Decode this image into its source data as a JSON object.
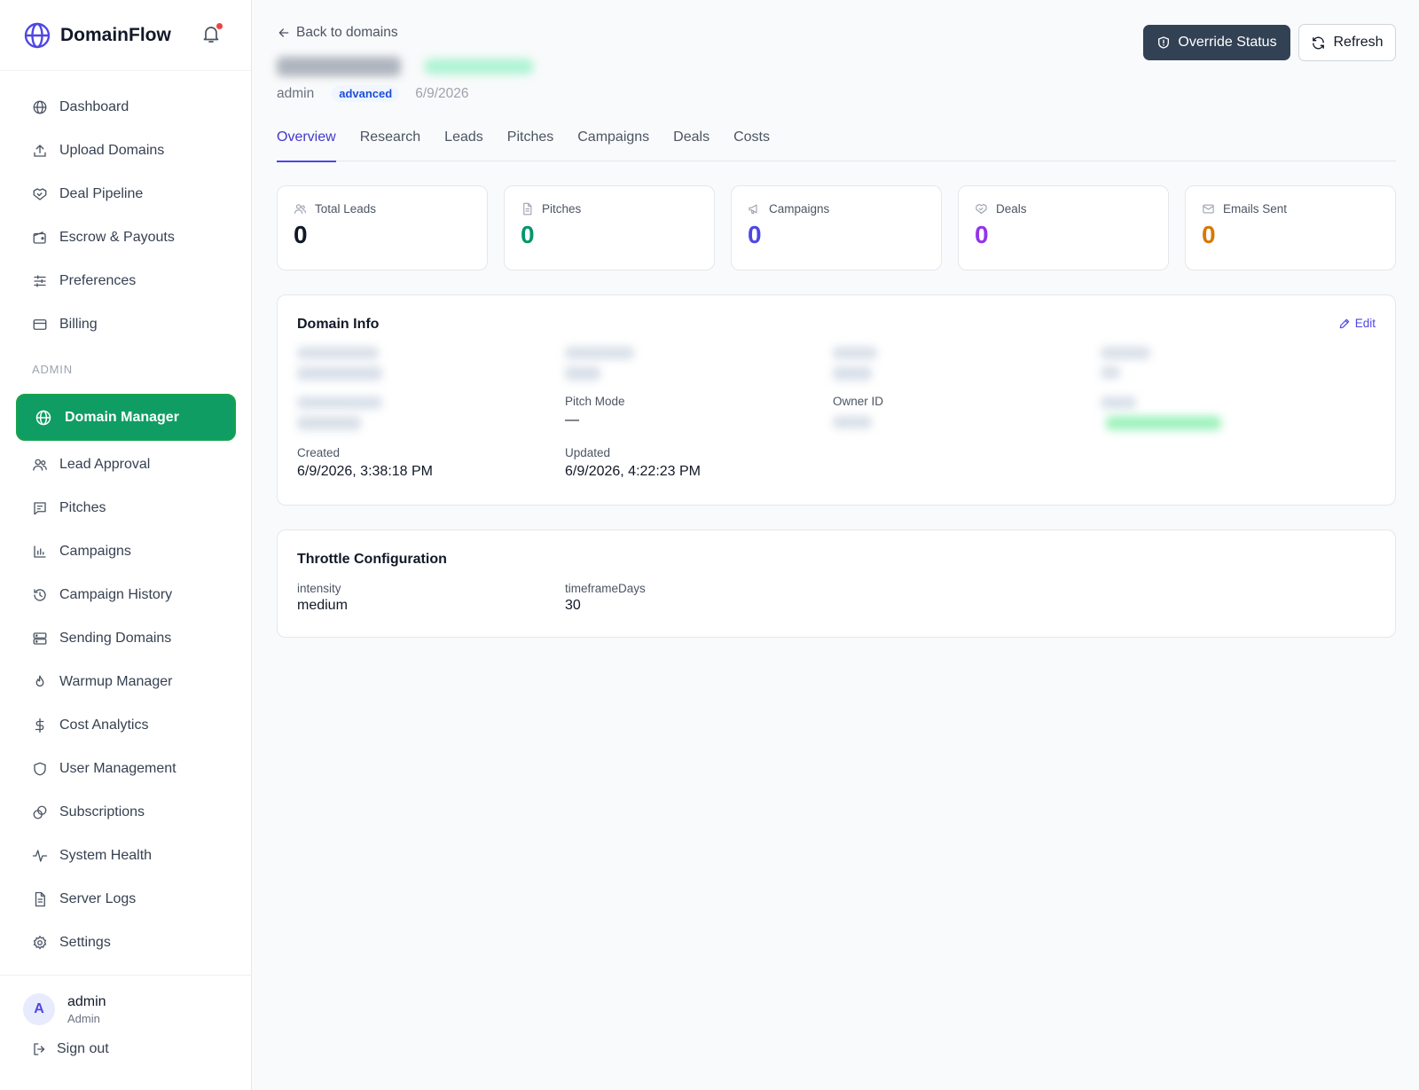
{
  "brand": {
    "name": "DomainFlow"
  },
  "nav": {
    "items": [
      {
        "label": "Dashboard",
        "icon": "globe-icon"
      },
      {
        "label": "Upload Domains",
        "icon": "upload-icon"
      },
      {
        "label": "Deal Pipeline",
        "icon": "handshake-icon"
      },
      {
        "label": "Escrow & Payouts",
        "icon": "wallet-icon"
      },
      {
        "label": "Preferences",
        "icon": "sliders-icon"
      },
      {
        "label": "Billing",
        "icon": "credit-card-icon"
      }
    ],
    "admin_section": "ADMIN",
    "admin_items": [
      {
        "label": "Domain Manager",
        "icon": "globe-icon",
        "active": true
      },
      {
        "label": "Lead Approval",
        "icon": "users-icon"
      },
      {
        "label": "Pitches",
        "icon": "message-square-icon"
      },
      {
        "label": "Campaigns",
        "icon": "bar-chart-icon"
      },
      {
        "label": "Campaign History",
        "icon": "history-icon"
      },
      {
        "label": "Sending Domains",
        "icon": "server-icon"
      },
      {
        "label": "Warmup Manager",
        "icon": "flame-icon"
      },
      {
        "label": "Cost Analytics",
        "icon": "dollar-icon"
      },
      {
        "label": "User Management",
        "icon": "shield-icon"
      },
      {
        "label": "Subscriptions",
        "icon": "coins-icon"
      },
      {
        "label": "System Health",
        "icon": "activity-icon"
      },
      {
        "label": "Server Logs",
        "icon": "file-text-icon"
      },
      {
        "label": "Settings",
        "icon": "gear-icon"
      }
    ]
  },
  "user": {
    "initial": "A",
    "name": "admin",
    "role": "Admin",
    "signout": "Sign out"
  },
  "header": {
    "back": "Back to domains",
    "owner": "admin",
    "tier": "advanced",
    "date": "6/9/2026",
    "override_label": "Override Status",
    "refresh_label": "Refresh"
  },
  "tabs": [
    "Overview",
    "Research",
    "Leads",
    "Pitches",
    "Campaigns",
    "Deals",
    "Costs"
  ],
  "stats": [
    {
      "label": "Total Leads",
      "value": "0",
      "color": "#111827",
      "icon": "users-icon"
    },
    {
      "label": "Pitches",
      "value": "0",
      "color": "#059669",
      "icon": "file-icon"
    },
    {
      "label": "Campaigns",
      "value": "0",
      "color": "#4f46e5",
      "icon": "megaphone-icon"
    },
    {
      "label": "Deals",
      "value": "0",
      "color": "#9333ea",
      "icon": "handshake-icon"
    },
    {
      "label": "Emails Sent",
      "value": "0",
      "color": "#d97706",
      "icon": "mail-icon"
    }
  ],
  "domain_info": {
    "title": "Domain Info",
    "edit": "Edit",
    "pitch_mode": {
      "label": "Pitch Mode",
      "value": "—"
    },
    "owner_id": {
      "label": "Owner ID"
    },
    "created": {
      "label": "Created",
      "value": "6/9/2026, 3:38:18 PM"
    },
    "updated": {
      "label": "Updated",
      "value": "6/9/2026, 4:22:23 PM"
    }
  },
  "throttle": {
    "title": "Throttle Configuration",
    "intensity": {
      "label": "intensity",
      "value": "medium"
    },
    "timeframe": {
      "label": "timeframeDays",
      "value": "30"
    }
  }
}
